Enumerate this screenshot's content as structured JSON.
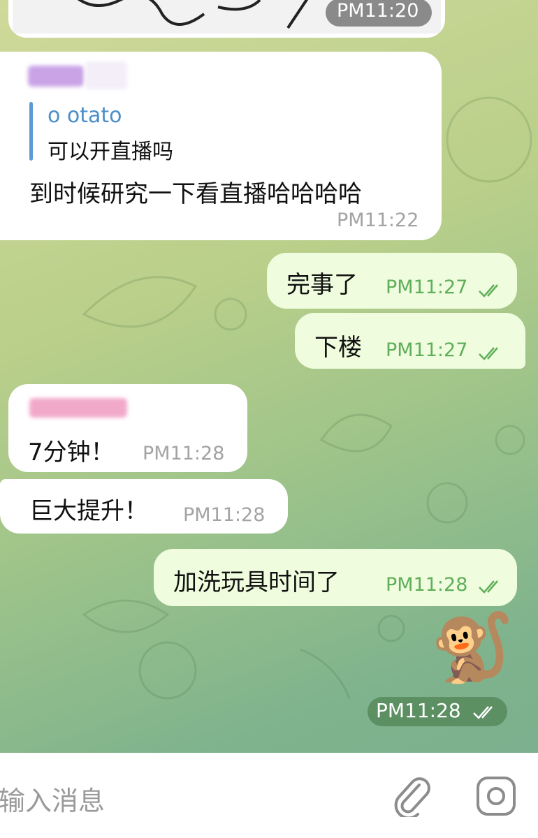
{
  "messages": {
    "top_image": {
      "time": "PM11:20"
    },
    "m1": {
      "reply_name": "o otato",
      "reply_text": "可以开直播吗",
      "text": "到时候研究一下看直播哈哈哈哈",
      "time": "PM11:22"
    },
    "m2": {
      "text": "完事了",
      "time": "PM11:27"
    },
    "m3": {
      "text": "下楼",
      "time": "PM11:27"
    },
    "m4": {
      "text": "7分钟！",
      "time": "PM11:28"
    },
    "m5": {
      "text": "巨大提升！",
      "time": "PM11:28"
    },
    "m6": {
      "text": "加洗玩具时间了",
      "time": "PM11:28"
    },
    "sticker": {
      "emoji": "🐒",
      "time": "PM11:28"
    }
  },
  "input": {
    "placeholder": "输入消息"
  },
  "icons": {
    "attach": "paperclip-icon",
    "camera": "camera-icon",
    "read": "double-check-icon"
  },
  "colors": {
    "accent_out_time": "#5fae5a",
    "reply_bar": "#5b9bd5"
  }
}
